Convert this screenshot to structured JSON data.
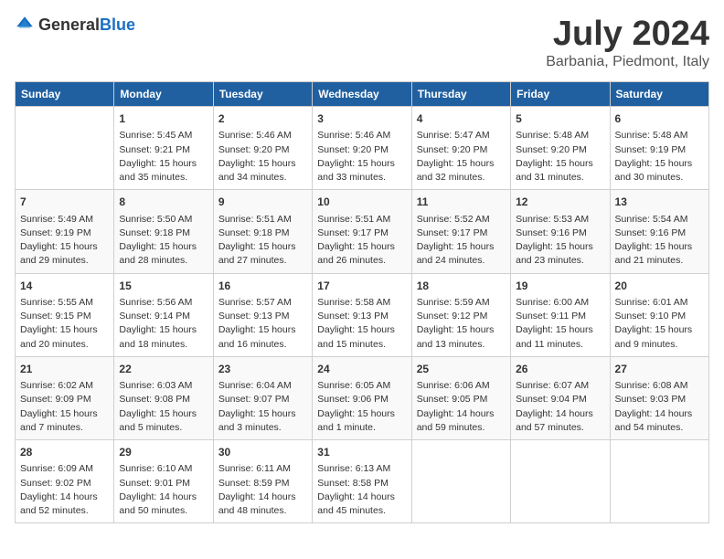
{
  "header": {
    "logo_general": "General",
    "logo_blue": "Blue",
    "title": "July 2024",
    "location": "Barbania, Piedmont, Italy"
  },
  "calendar": {
    "days_of_week": [
      "Sunday",
      "Monday",
      "Tuesday",
      "Wednesday",
      "Thursday",
      "Friday",
      "Saturday"
    ],
    "weeks": [
      [
        {
          "day": "",
          "info": ""
        },
        {
          "day": "1",
          "info": "Sunrise: 5:45 AM\nSunset: 9:21 PM\nDaylight: 15 hours\nand 35 minutes."
        },
        {
          "day": "2",
          "info": "Sunrise: 5:46 AM\nSunset: 9:20 PM\nDaylight: 15 hours\nand 34 minutes."
        },
        {
          "day": "3",
          "info": "Sunrise: 5:46 AM\nSunset: 9:20 PM\nDaylight: 15 hours\nand 33 minutes."
        },
        {
          "day": "4",
          "info": "Sunrise: 5:47 AM\nSunset: 9:20 PM\nDaylight: 15 hours\nand 32 minutes."
        },
        {
          "day": "5",
          "info": "Sunrise: 5:48 AM\nSunset: 9:20 PM\nDaylight: 15 hours\nand 31 minutes."
        },
        {
          "day": "6",
          "info": "Sunrise: 5:48 AM\nSunset: 9:19 PM\nDaylight: 15 hours\nand 30 minutes."
        }
      ],
      [
        {
          "day": "7",
          "info": "Sunrise: 5:49 AM\nSunset: 9:19 PM\nDaylight: 15 hours\nand 29 minutes."
        },
        {
          "day": "8",
          "info": "Sunrise: 5:50 AM\nSunset: 9:18 PM\nDaylight: 15 hours\nand 28 minutes."
        },
        {
          "day": "9",
          "info": "Sunrise: 5:51 AM\nSunset: 9:18 PM\nDaylight: 15 hours\nand 27 minutes."
        },
        {
          "day": "10",
          "info": "Sunrise: 5:51 AM\nSunset: 9:17 PM\nDaylight: 15 hours\nand 26 minutes."
        },
        {
          "day": "11",
          "info": "Sunrise: 5:52 AM\nSunset: 9:17 PM\nDaylight: 15 hours\nand 24 minutes."
        },
        {
          "day": "12",
          "info": "Sunrise: 5:53 AM\nSunset: 9:16 PM\nDaylight: 15 hours\nand 23 minutes."
        },
        {
          "day": "13",
          "info": "Sunrise: 5:54 AM\nSunset: 9:16 PM\nDaylight: 15 hours\nand 21 minutes."
        }
      ],
      [
        {
          "day": "14",
          "info": "Sunrise: 5:55 AM\nSunset: 9:15 PM\nDaylight: 15 hours\nand 20 minutes."
        },
        {
          "day": "15",
          "info": "Sunrise: 5:56 AM\nSunset: 9:14 PM\nDaylight: 15 hours\nand 18 minutes."
        },
        {
          "day": "16",
          "info": "Sunrise: 5:57 AM\nSunset: 9:13 PM\nDaylight: 15 hours\nand 16 minutes."
        },
        {
          "day": "17",
          "info": "Sunrise: 5:58 AM\nSunset: 9:13 PM\nDaylight: 15 hours\nand 15 minutes."
        },
        {
          "day": "18",
          "info": "Sunrise: 5:59 AM\nSunset: 9:12 PM\nDaylight: 15 hours\nand 13 minutes."
        },
        {
          "day": "19",
          "info": "Sunrise: 6:00 AM\nSunset: 9:11 PM\nDaylight: 15 hours\nand 11 minutes."
        },
        {
          "day": "20",
          "info": "Sunrise: 6:01 AM\nSunset: 9:10 PM\nDaylight: 15 hours\nand 9 minutes."
        }
      ],
      [
        {
          "day": "21",
          "info": "Sunrise: 6:02 AM\nSunset: 9:09 PM\nDaylight: 15 hours\nand 7 minutes."
        },
        {
          "day": "22",
          "info": "Sunrise: 6:03 AM\nSunset: 9:08 PM\nDaylight: 15 hours\nand 5 minutes."
        },
        {
          "day": "23",
          "info": "Sunrise: 6:04 AM\nSunset: 9:07 PM\nDaylight: 15 hours\nand 3 minutes."
        },
        {
          "day": "24",
          "info": "Sunrise: 6:05 AM\nSunset: 9:06 PM\nDaylight: 15 hours\nand 1 minute."
        },
        {
          "day": "25",
          "info": "Sunrise: 6:06 AM\nSunset: 9:05 PM\nDaylight: 14 hours\nand 59 minutes."
        },
        {
          "day": "26",
          "info": "Sunrise: 6:07 AM\nSunset: 9:04 PM\nDaylight: 14 hours\nand 57 minutes."
        },
        {
          "day": "27",
          "info": "Sunrise: 6:08 AM\nSunset: 9:03 PM\nDaylight: 14 hours\nand 54 minutes."
        }
      ],
      [
        {
          "day": "28",
          "info": "Sunrise: 6:09 AM\nSunset: 9:02 PM\nDaylight: 14 hours\nand 52 minutes."
        },
        {
          "day": "29",
          "info": "Sunrise: 6:10 AM\nSunset: 9:01 PM\nDaylight: 14 hours\nand 50 minutes."
        },
        {
          "day": "30",
          "info": "Sunrise: 6:11 AM\nSunset: 8:59 PM\nDaylight: 14 hours\nand 48 minutes."
        },
        {
          "day": "31",
          "info": "Sunrise: 6:13 AM\nSunset: 8:58 PM\nDaylight: 14 hours\nand 45 minutes."
        },
        {
          "day": "",
          "info": ""
        },
        {
          "day": "",
          "info": ""
        },
        {
          "day": "",
          "info": ""
        }
      ]
    ]
  }
}
